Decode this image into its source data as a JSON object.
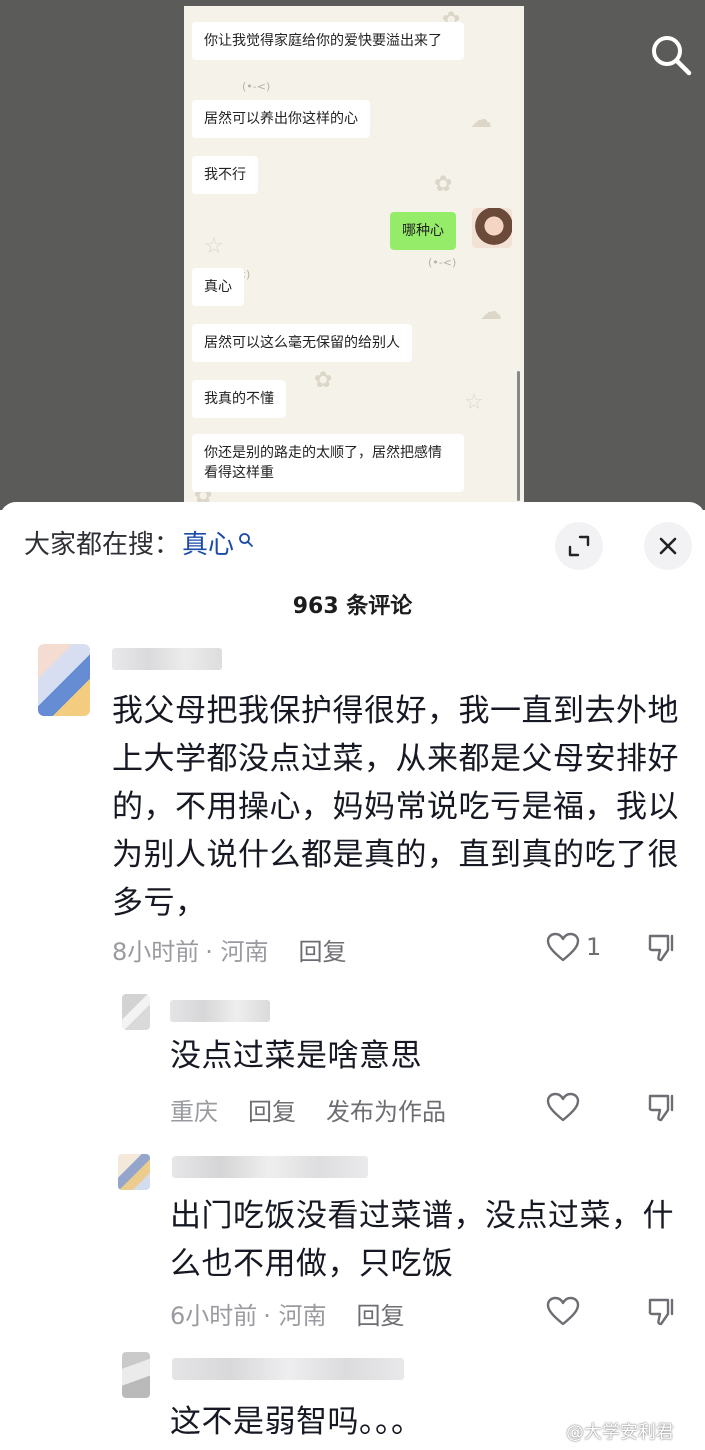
{
  "chat_screenshot": {
    "messages": [
      {
        "side": "left",
        "text": "你让我觉得家庭给你的爱快要溢出来了"
      },
      {
        "side": "left",
        "text": "居然可以养出你这样的心"
      },
      {
        "side": "left",
        "text": "我不行"
      },
      {
        "side": "right",
        "text": "哪种心"
      },
      {
        "side": "left",
        "text": "真心"
      },
      {
        "side": "left",
        "text": "居然可以这么毫无保留的给别人"
      },
      {
        "side": "left",
        "text": "我真的不懂"
      },
      {
        "side": "left",
        "text": "你还是别的路走的太顺了，居然把感情看得这样重"
      }
    ],
    "emoticon": "(•-<)"
  },
  "header": {
    "search_prefix": "大家都在搜：",
    "search_keyword": "真心",
    "comment_count_title": "963 条评论"
  },
  "comments": [
    {
      "text": "我父母把我保护得很好，我一直到去外地上大学都没点过菜，从来都是父母安排好的，不用操心，妈妈常说吃亏是福，我以为别人说什么都是真的，直到真的吃了很多亏，",
      "time": "8小时前",
      "location": "· 河南",
      "reply_label": "回复",
      "likes": "1"
    },
    {
      "text": "没点过菜是啥意思",
      "location": "重庆",
      "reply_label": "回复",
      "publish_label": "发布为作品"
    },
    {
      "text": "出门吃饭没看过菜谱，没点过菜，什么也不用做，只吃饭",
      "time": "6小时前",
      "location": "· 河南",
      "reply_label": "回复"
    },
    {
      "text": "这不是弱智吗。。。"
    }
  ],
  "watermark": "@大学安利君",
  "icons": [
    "search-icon",
    "expand-icon",
    "close-icon",
    "heart-icon",
    "thumbs-down-icon"
  ],
  "colors": {
    "keyword": "#1b4ba8",
    "me_bubble": "#95ec69",
    "video_bg": "#5b5b59"
  }
}
